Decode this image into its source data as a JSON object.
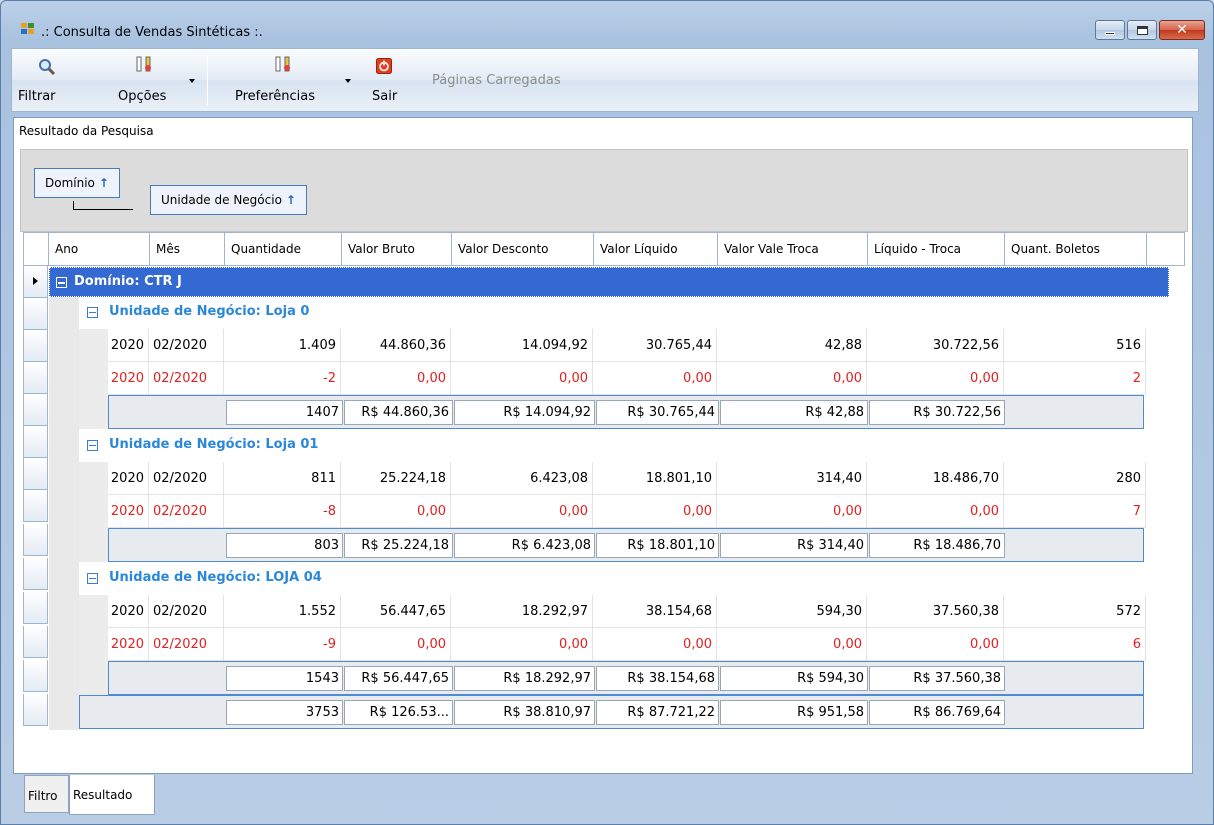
{
  "window": {
    "title": ".: Consulta de Vendas Sintéticas :.",
    "accent": "#3369d1"
  },
  "toolbar": {
    "filtrar": "Filtrar",
    "opcoes": "Opções",
    "preferencias": "Preferências",
    "sair": "Sair",
    "paginas": "Páginas Carregadas"
  },
  "panel": {
    "title": "Resultado da Pesquisa",
    "group_by": [
      {
        "label": "Domínio",
        "sort": "↑"
      },
      {
        "label": "Unidade de Negócio",
        "sort": "↑"
      }
    ]
  },
  "grid": {
    "columns": [
      "Ano",
      "Mês",
      "Quantidade",
      "Valor Bruto",
      "Valor Desconto",
      "Valor Líquido",
      "Valor Vale Troca",
      "Líquido - Troca",
      "Quant. Boletos"
    ],
    "domain_label": "Domínio: CTR J",
    "units": [
      {
        "label": "Unidade de Negócio: Loja 0",
        "rows": [
          {
            "ano": "2020",
            "mes": "02/2020",
            "qtd": "1.409",
            "bruto": "44.860,36",
            "desc": "14.094,92",
            "liq": "30.765,44",
            "vale": "42,88",
            "liqtroca": "30.722,56",
            "bol": "516"
          },
          {
            "ano": "2020",
            "mes": "02/2020",
            "qtd": "-2",
            "bruto": "0,00",
            "desc": "0,00",
            "liq": "0,00",
            "vale": "0,00",
            "liqtroca": "0,00",
            "bol": "2"
          }
        ],
        "summary": {
          "qtd": "1407",
          "bruto": "R$ 44.860,36",
          "desc": "R$ 14.094,92",
          "liq": "R$ 30.765,44",
          "vale": "R$ 42,88",
          "liqtroca": "R$ 30.722,56"
        }
      },
      {
        "label": "Unidade de Negócio: Loja 01",
        "rows": [
          {
            "ano": "2020",
            "mes": "02/2020",
            "qtd": "811",
            "bruto": "25.224,18",
            "desc": "6.423,08",
            "liq": "18.801,10",
            "vale": "314,40",
            "liqtroca": "18.486,70",
            "bol": "280"
          },
          {
            "ano": "2020",
            "mes": "02/2020",
            "qtd": "-8",
            "bruto": "0,00",
            "desc": "0,00",
            "liq": "0,00",
            "vale": "0,00",
            "liqtroca": "0,00",
            "bol": "7"
          }
        ],
        "summary": {
          "qtd": "803",
          "bruto": "R$ 25.224,18",
          "desc": "R$ 6.423,08",
          "liq": "R$ 18.801,10",
          "vale": "R$ 314,40",
          "liqtroca": "R$ 18.486,70"
        }
      },
      {
        "label": "Unidade de Negócio: LOJA 04",
        "rows": [
          {
            "ano": "2020",
            "mes": "02/2020",
            "qtd": "1.552",
            "bruto": "56.447,65",
            "desc": "18.292,97",
            "liq": "38.154,68",
            "vale": "594,30",
            "liqtroca": "37.560,38",
            "bol": "572"
          },
          {
            "ano": "2020",
            "mes": "02/2020",
            "qtd": "-9",
            "bruto": "0,00",
            "desc": "0,00",
            "liq": "0,00",
            "vale": "0,00",
            "liqtroca": "0,00",
            "bol": "6"
          }
        ],
        "summary": {
          "qtd": "1543",
          "bruto": "R$ 56.447,65",
          "desc": "R$ 18.292,97",
          "liq": "R$ 38.154,68",
          "vale": "R$ 594,30",
          "liqtroca": "R$ 37.560,38"
        }
      }
    ],
    "grand_total": {
      "qtd": "3753",
      "bruto": "R$ 126.53...",
      "desc": "R$ 38.810,97",
      "liq": "R$ 87.721,22",
      "vale": "R$ 951,58",
      "liqtroca": "R$ 86.769,64"
    }
  },
  "tabs": [
    "Filtro",
    "Resultado"
  ]
}
